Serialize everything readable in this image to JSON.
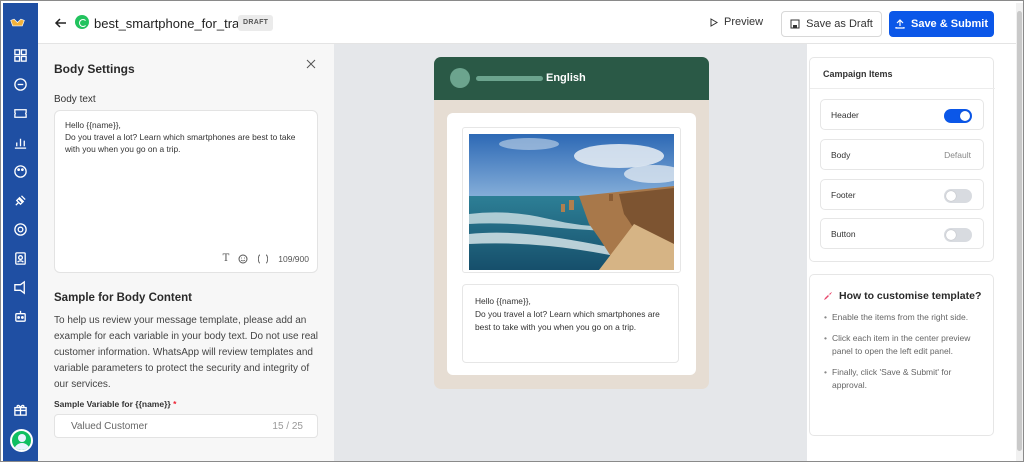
{
  "topbar": {
    "title": "best_smartphone_for_travel",
    "status_badge": "DRAFT",
    "preview_label": "Preview",
    "save_draft_label": "Save as Draft",
    "submit_label": "Save & Submit"
  },
  "left_panel": {
    "title": "Body Settings",
    "body_label": "Body text",
    "body_value": "Hello {{name}},\nDo you travel a lot? Learn which smartphones are best to take with you when you go on a trip.",
    "char_count": "109/900",
    "sample_heading": "Sample for Body Content",
    "sample_description": "To help us review your message template, please add an example for each variable in your body text. Do not use real customer information. WhatsApp will review templates and variable parameters to protect the security and integrity of our services.",
    "variable_label": "Sample Variable for {{name}}",
    "required_mark": "*",
    "variable_value": "Valued Customer",
    "variable_count": "15 / 25"
  },
  "preview": {
    "language": "English",
    "message": "Hello {{name}},\nDo you travel a lot? Learn which smartphones are best to take with you when you go on a trip."
  },
  "campaign_items": {
    "title": "Campaign Items",
    "items": [
      {
        "label": "Header",
        "toggle": true
      },
      {
        "label": "Body",
        "value": "Default"
      },
      {
        "label": "Footer",
        "toggle": false
      },
      {
        "label": "Button",
        "toggle": false
      }
    ]
  },
  "help": {
    "title": "How to customise template?",
    "tips": [
      "Enable the items from the right side.",
      "Click each item in the center preview panel to open the left edit panel.",
      "Finally, click 'Save & Submit' for approval."
    ]
  },
  "colors": {
    "accent": "#0b57e8",
    "sidebar": "#1f4fa3",
    "whatsapp_header": "#2a5946",
    "whatsapp_green": "#22c35e"
  }
}
